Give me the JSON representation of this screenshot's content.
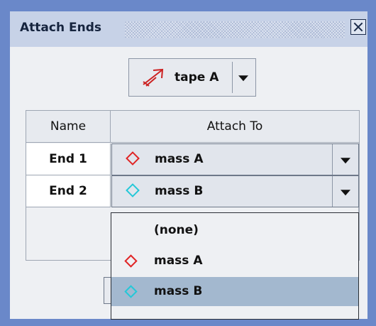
{
  "window": {
    "title": "Attach Ends",
    "close_icon": "close-icon"
  },
  "tape_selector": {
    "selected": "tape A",
    "icon": "tape-arrow-icon",
    "icon_color": "#cc2222"
  },
  "table": {
    "columns": [
      "Name",
      "Attach To"
    ],
    "rows": [
      {
        "name": "End 1",
        "attach_to": "mass A",
        "diamond_color": "#e02424"
      },
      {
        "name": "End 2",
        "attach_to": "mass B",
        "diamond_color": "#24c8d8"
      }
    ]
  },
  "dropdown": {
    "options": [
      {
        "label": "(none)",
        "diamond_color": ""
      },
      {
        "label": "mass A",
        "diamond_color": "#e02424"
      },
      {
        "label": "mass B",
        "diamond_color": "#24c8d8",
        "selected": true
      }
    ],
    "selected_bg": "#a3b8cf"
  }
}
